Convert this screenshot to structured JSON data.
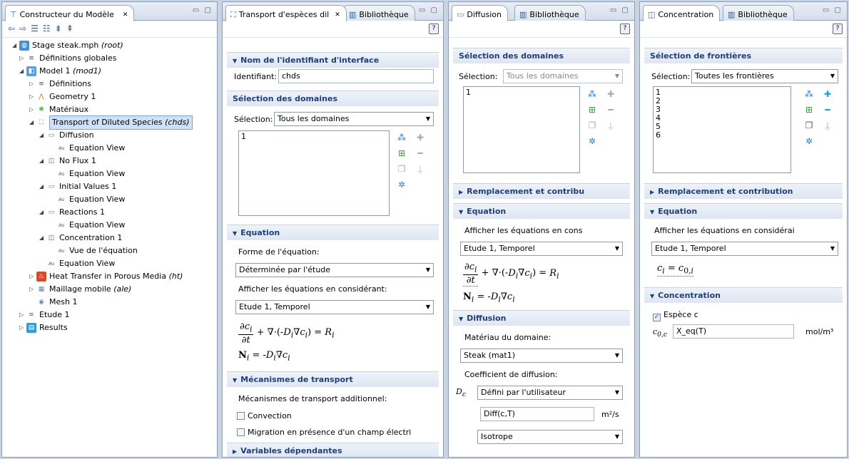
{
  "builder": {
    "tab_label": "Constructeur du Modèle",
    "tree": [
      {
        "label": "Stage steak.mph",
        "suffix": "(root)",
        "icon": "model-file-icon"
      },
      {
        "label": "Définitions globales",
        "suffix": "",
        "icon": "definitions-icon"
      },
      {
        "label": "Model 1",
        "suffix": "(mod1)",
        "icon": "model-icon"
      },
      {
        "label": "Définitions",
        "suffix": "",
        "icon": "definitions-icon"
      },
      {
        "label": "Geometry 1",
        "suffix": "",
        "icon": "geometry-icon"
      },
      {
        "label": "Matériaux",
        "suffix": "",
        "icon": "materials-icon"
      },
      {
        "label": "Transport of Diluted Species",
        "suffix": "(chds)",
        "icon": "physics-icon"
      },
      {
        "label": "Diffusion",
        "suffix": "",
        "icon": "domain-feature-icon"
      },
      {
        "label": "Equation View",
        "suffix": "",
        "icon": "equation-icon"
      },
      {
        "label": "No Flux 1",
        "suffix": "",
        "icon": "boundary-feature-icon"
      },
      {
        "label": "Equation View",
        "suffix": "",
        "icon": "equation-icon"
      },
      {
        "label": "Initial Values 1",
        "suffix": "",
        "icon": "domain-feature-icon"
      },
      {
        "label": "Equation View",
        "suffix": "",
        "icon": "equation-icon"
      },
      {
        "label": "Reactions 1",
        "suffix": "",
        "icon": "domain-feature-icon"
      },
      {
        "label": "Equation View",
        "suffix": "",
        "icon": "equation-icon"
      },
      {
        "label": "Concentration 1",
        "suffix": "",
        "icon": "boundary-feature-icon"
      },
      {
        "label": "Vue de l'équation",
        "suffix": "",
        "icon": "equation-icon"
      },
      {
        "label": "Equation View",
        "suffix": "",
        "icon": "equation-icon"
      },
      {
        "label": "Heat Transfer in Porous Media",
        "suffix": "(ht)",
        "icon": "heat-transfer-icon"
      },
      {
        "label": "Maillage mobile",
        "suffix": "(ale)",
        "icon": "moving-mesh-icon"
      },
      {
        "label": "Mesh 1",
        "suffix": "",
        "icon": "mesh-icon"
      },
      {
        "label": "Etude 1",
        "suffix": "",
        "icon": "study-icon"
      },
      {
        "label": "Results",
        "suffix": "",
        "icon": "results-icon"
      }
    ]
  },
  "transport": {
    "tab_label": "Transport d'espèces dil",
    "library_tab": "Bibliothèque",
    "sec_identifier": "Nom de l'identifiant d'interface",
    "identifier_label": "Identifiant:",
    "identifier_value": "chds",
    "sec_domains": "Sélection des domaines",
    "selection_label": "Sélection:",
    "selection_value": "Tous les domaines",
    "list_item": "1",
    "sec_equation": "Equation",
    "form_label": "Forme de l'équation:",
    "form_value": "Déterminée par l'étude",
    "show_label": "Afficher les équations en considérant:",
    "show_value": "Etude 1, Temporel",
    "sec_mechanisms": "Mécanismes de transport",
    "mech_label": "Mécanismes de transport additionnel:",
    "convection": "Convection",
    "migration": "Migration en présence d'un champ électri",
    "sec_variables": "Variables dépendantes"
  },
  "diffusion": {
    "tab_label": "Diffusion",
    "library_tab": "Bibliothèque",
    "sec_domains": "Sélection des domaines",
    "selection_label": "Sélection:",
    "selection_value": "Tous les domaines",
    "list_item": "1",
    "sec_override": "Remplacement et contribu",
    "sec_equation": "Equation",
    "show_label": "Afficher les équations en cons",
    "show_value": "Etude 1, Temporel",
    "sec_diffusion": "Diffusion",
    "material_label": "Matériau du domaine:",
    "material_value": "Steak (mat1)",
    "coef_label": "Coefficient de diffusion:",
    "dc_symbol": "D",
    "dc_sub": "c",
    "dc_value": "Défini par l'utilisateur",
    "diff_value": "Diff(c,T)",
    "diff_unit": "m²/s",
    "isotropy_value": "Isotrope"
  },
  "concentration": {
    "tab_label": "Concentration",
    "library_tab": "Bibliothèque",
    "sec_boundaries": "Sélection de frontières",
    "selection_label": "Sélection:",
    "selection_value": "Toutes les frontières",
    "list_items": [
      "1",
      "2",
      "3",
      "4",
      "5",
      "6"
    ],
    "sec_override": "Remplacement et contribution",
    "sec_equation": "Equation",
    "show_label": "Afficher les équations en considérai",
    "show_value": "Etude 1, Temporel",
    "sec_concentration": "Concentration",
    "species_label": "Espèce c",
    "c0_symbol": "c",
    "c0_sub": "0,c",
    "c0_value": "X_eq(T)",
    "c0_unit": "mol/m³"
  }
}
